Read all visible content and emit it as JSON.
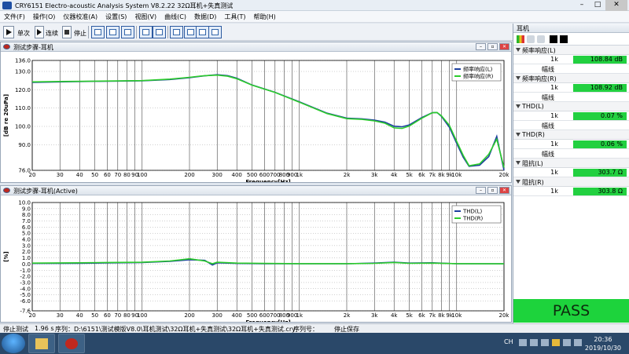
{
  "window": {
    "title": "CRY6151 Electro-acoustic Analysis System  V8.2.22 32Ω耳机+失真测试"
  },
  "menu": [
    "文件(F)",
    "操作(O)",
    "仪器校准(A)",
    "设置(S)",
    "视图(V)",
    "曲线(C)",
    "数据(D)",
    "工具(T)",
    "帮助(H)"
  ],
  "toolbar": {
    "single": "单次",
    "continuous": "连续",
    "stop": "停止"
  },
  "panel_top": {
    "title": "测试步骤-耳机",
    "legend": [
      "频率响应(L)",
      "频率响应(R)"
    ]
  },
  "panel_bottom": {
    "title": "测试步骤-耳机(Active)",
    "legend": [
      "THD(L)",
      "THD(R)"
    ]
  },
  "chart_data": [
    {
      "type": "line",
      "ylabel": "[dB re 20uPa]",
      "xlabel": "Frequency[Hz]",
      "x_scale": "log",
      "xlim": [
        20,
        20000
      ],
      "ylim": [
        76,
        136
      ],
      "y_ticks": [
        "136.0",
        "130.0",
        "120.0",
        "110.0",
        "100.0",
        "90.0",
        "76.0"
      ],
      "x_ticks": [
        "20",
        "30",
        "40",
        "50",
        "60",
        "70",
        "80",
        "90",
        "100",
        "200",
        "300",
        "400",
        "500",
        "600",
        "700",
        "800",
        "900",
        "1k",
        "2k",
        "3k",
        "4k",
        "5k",
        "6k",
        "7k",
        "8k",
        "9k",
        "10k",
        "20k"
      ],
      "grid": true,
      "legend": "top-right",
      "series": [
        {
          "name": "频率响应(L)",
          "color": "#1c3f9e",
          "x": [
            20,
            30,
            50,
            100,
            150,
            200,
            250,
            300,
            350,
            400,
            500,
            700,
            1000,
            1500,
            2000,
            2500,
            3000,
            3500,
            4000,
            4500,
            5000,
            6000,
            7000,
            7500,
            8000,
            9000,
            10000,
            11000,
            12000,
            14000,
            16000,
            18000,
            20000
          ],
          "y": [
            124,
            124.3,
            124.6,
            124.9,
            125.6,
            126.6,
            127.6,
            128.2,
            127.7,
            126.3,
            122.6,
            118.6,
            113.4,
            107.2,
            104.5,
            104.1,
            103.4,
            102.3,
            100.1,
            99.8,
            100.8,
            104.8,
            107.5,
            107.6,
            105.5,
            99.5,
            90.8,
            83.2,
            78.2,
            78.8,
            83.5,
            94.5,
            76
          ]
        },
        {
          "name": "频率响应(R)",
          "color": "#2ccc2c",
          "x": [
            20,
            30,
            50,
            100,
            150,
            200,
            250,
            300,
            350,
            400,
            500,
            700,
            1000,
            1500,
            2000,
            2500,
            3000,
            3500,
            4000,
            4500,
            5000,
            6000,
            7000,
            7500,
            8000,
            9000,
            10000,
            11000,
            12000,
            14000,
            16000,
            18000,
            20000
          ],
          "y": [
            124.3,
            124.5,
            124.7,
            125.0,
            125.8,
            126.8,
            127.7,
            128.0,
            127.4,
            126.0,
            122.5,
            118.5,
            113.2,
            107.0,
            104.2,
            103.8,
            103.0,
            101.7,
            99.2,
            98.9,
            100.2,
            104.4,
            107.4,
            107.6,
            105.8,
            100.5,
            91.8,
            84.2,
            78.5,
            79.5,
            84.8,
            93.0,
            77.5
          ]
        }
      ]
    },
    {
      "type": "line",
      "ylabel": "[%]",
      "xlabel": "Frequency[Hz]",
      "x_scale": "log",
      "xlim": [
        20,
        20000
      ],
      "ylim": [
        -7.6,
        10
      ],
      "y_ticks": [
        "10.0",
        "9.0",
        "8.0",
        "7.0",
        "6.0",
        "5.0",
        "4.0",
        "3.0",
        "2.0",
        "1.0",
        "0.0",
        "-1.0",
        "-2.0",
        "-3.0",
        "-4.0",
        "-5.0",
        "-6.0",
        "-7.6"
      ],
      "x_ticks": [
        "20",
        "30",
        "40",
        "50",
        "60",
        "70",
        "80",
        "90",
        "100",
        "200",
        "300",
        "400",
        "500",
        "600",
        "700",
        "800",
        "900",
        "1k",
        "2k",
        "3k",
        "4k",
        "5k",
        "6k",
        "7k",
        "8k",
        "9k",
        "10k",
        "20k"
      ],
      "grid": true,
      "legend": "top-right",
      "series": [
        {
          "name": "THD(L)",
          "color": "#1c3f9e",
          "x": [
            20,
            40,
            60,
            100,
            150,
            200,
            250,
            280,
            300,
            400,
            600,
            1000,
            2000,
            3000,
            4000,
            5000,
            7000,
            10000,
            20000
          ],
          "y": [
            0.1,
            0.12,
            0.18,
            0.25,
            0.45,
            0.7,
            0.6,
            -0.15,
            0.2,
            0.1,
            0.05,
            0.05,
            0.05,
            0.15,
            0.3,
            0.15,
            0.2,
            0.05,
            0.05
          ]
        },
        {
          "name": "THD(R)",
          "color": "#2ccc2c",
          "x": [
            20,
            40,
            60,
            100,
            150,
            200,
            250,
            280,
            300,
            400,
            600,
            1000,
            2000,
            3000,
            4000,
            5000,
            7000,
            10000,
            20000
          ],
          "y": [
            0.15,
            0.2,
            0.25,
            0.3,
            0.5,
            0.85,
            0.5,
            0.05,
            0.3,
            0.15,
            0.1,
            0.06,
            0.06,
            0.12,
            0.25,
            0.12,
            0.15,
            0.06,
            0.04
          ]
        }
      ]
    }
  ],
  "results": {
    "title": "耳机",
    "sections": [
      {
        "name": "频率响应(L)",
        "key": "1k",
        "value": "108.84 dB",
        "extra": "幅线"
      },
      {
        "name": "频率响应(R)",
        "key": "1k",
        "value": "108.92 dB",
        "extra": "幅线"
      },
      {
        "name": "THD(L)",
        "key": "1k",
        "value": "0.07 %",
        "extra": "幅线"
      },
      {
        "name": "THD(R)",
        "key": "1k",
        "value": "0.06 %",
        "extra": "幅线"
      },
      {
        "name": "阻抗(L)",
        "key": "1k",
        "value": "303.7 Ω"
      },
      {
        "name": "阻抗(R)",
        "key": "1k",
        "value": "303.8 Ω"
      }
    ],
    "verdict": "PASS"
  },
  "statusbar": {
    "state": "停止测试",
    "time": "1.96 s",
    "sequence": "序列：D:\\6151\\测试模版V8.0\\耳机测试\\32Ω耳机+失真测试\\32Ω耳机+失真测试.cry",
    "seq_no": "序列号：",
    "save": "停止保存"
  },
  "taskbar": {
    "ch": "CH",
    "time": "20:36",
    "date": "2019/10/30"
  }
}
